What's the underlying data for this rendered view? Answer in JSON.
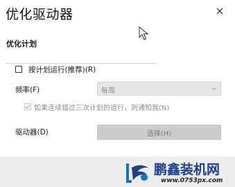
{
  "dialog": {
    "title": "优化驱动器",
    "close_icon": "close-icon"
  },
  "schedule": {
    "section_title": "优化计划",
    "run_on_schedule_label": "按计划运行(推荐)(R)",
    "run_on_schedule_checked": false,
    "frequency_label": "频率(F)",
    "frequency_value": "每周",
    "notify_label": "如果连续错过三次计划的运行，则通知我(N)",
    "notify_checked": true,
    "drives_label": "驱动器(D)",
    "choose_button_label": "选择(H)"
  },
  "watermark": {
    "title": "鹏鑫装机网",
    "url": "www.0753px.com"
  },
  "colors": {
    "disabled_text": "#8a8a8a",
    "control_disabled_bg": "#e6e6e6",
    "button_disabled_bg": "#cccccc",
    "watermark_blue": "#1d3f8f",
    "footer_bg": "#ededed"
  }
}
